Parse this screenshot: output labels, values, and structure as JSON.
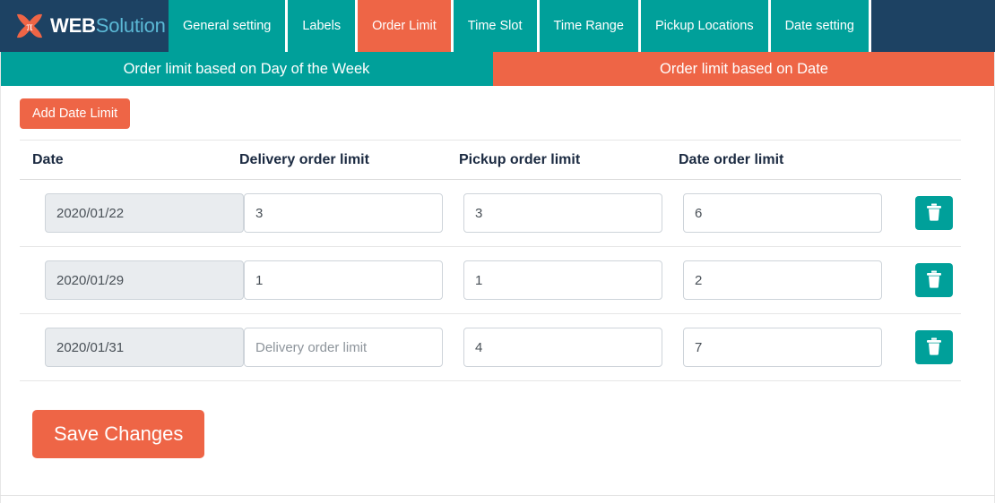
{
  "brand": {
    "logo_icon": "x-pi-logo-icon",
    "name_primary": "WEB",
    "name_secondary": "Solution"
  },
  "nav": {
    "tabs": [
      {
        "label": "General setting",
        "active": false
      },
      {
        "label": "Labels",
        "active": false
      },
      {
        "label": "Order Limit",
        "active": true
      },
      {
        "label": "Time Slot",
        "active": false
      },
      {
        "label": "Time Range",
        "active": false
      },
      {
        "label": "Pickup Locations",
        "active": false
      },
      {
        "label": "Date setting",
        "active": false
      }
    ]
  },
  "subtabs": [
    {
      "label": "Order limit based on Day of the Week",
      "active": false
    },
    {
      "label": "Order limit based on Date",
      "active": true
    }
  ],
  "toolbar": {
    "add_label": "Add Date Limit"
  },
  "table": {
    "headers": [
      "Date",
      "Delivery order limit",
      "Pickup order limit",
      "Date order limit"
    ],
    "rows": [
      {
        "date": "2020/01/22",
        "delivery": "3",
        "pickup": "3",
        "date_limit": "6",
        "delete_icon": "trash-icon"
      },
      {
        "date": "2020/01/29",
        "delivery": "1",
        "pickup": "1",
        "date_limit": "2",
        "delete_icon": "trash-icon"
      },
      {
        "date": "2020/01/31",
        "delivery": "",
        "pickup": "4",
        "date_limit": "7",
        "delete_icon": "trash-icon"
      }
    ],
    "placeholders": {
      "date": "Date",
      "delivery": "Delivery order limit",
      "pickup": "Pickup order limit",
      "date_limit": "Date order limit"
    }
  },
  "footer": {
    "save_label": "Save Changes"
  },
  "colors": {
    "teal": "#00a09a",
    "orange": "#ee6546",
    "navy": "#1d4263",
    "brand_light_blue": "#5bb9d6",
    "input_border": "#ced4da",
    "readonly_bg": "#e9ecef"
  }
}
